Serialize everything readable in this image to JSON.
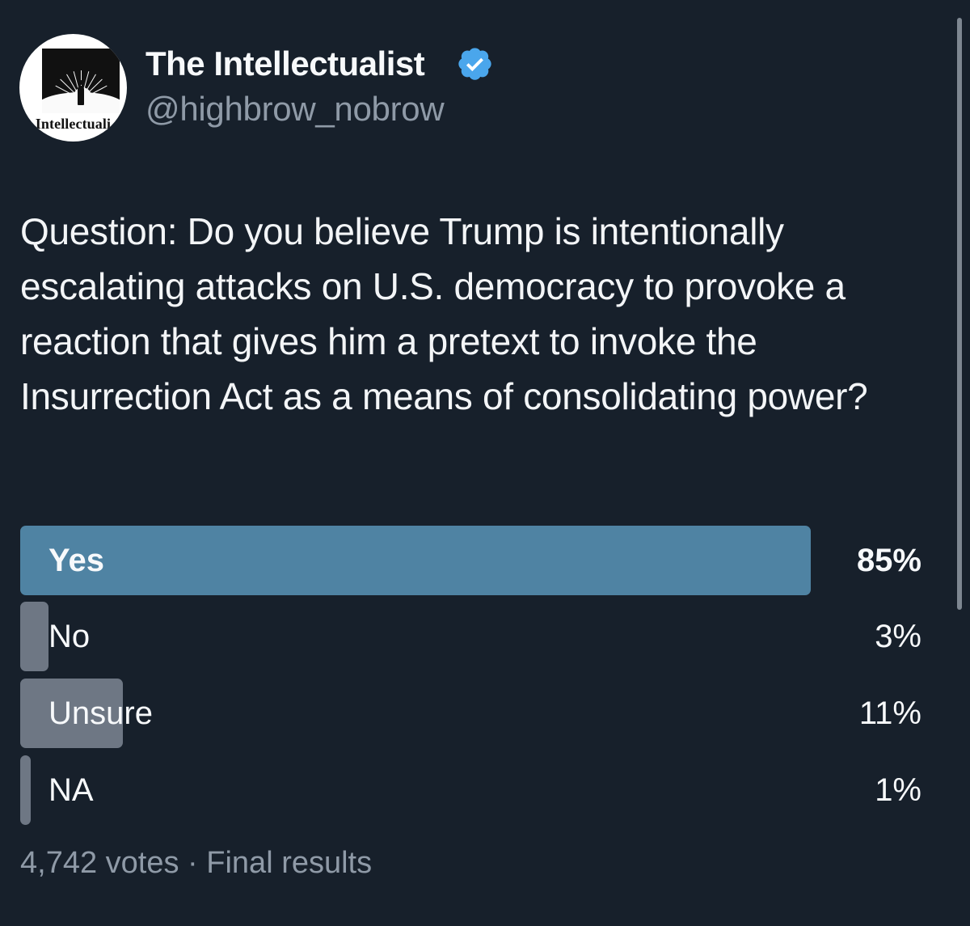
{
  "account": {
    "name": "The Intellectualist",
    "handle": "@highbrow_nobrow",
    "avatar_text": "he Intellectuali",
    "verified_icon": "verified-badge-icon",
    "accent": "#4aa6ec"
  },
  "tweet": {
    "text": "Question: Do you believe Trump is intentionally escalating attacks on U.S. democracy to provoke a reaction that gives him a pretext to invoke the Insurrection Act as a means of consolidating power?"
  },
  "poll": {
    "options": [
      {
        "label": "Yes",
        "percent_text": "85%",
        "percent": 85,
        "winner": true
      },
      {
        "label": "No",
        "percent_text": "3%",
        "percent": 3,
        "winner": false
      },
      {
        "label": "Unsure",
        "percent_text": "11%",
        "percent": 11,
        "winner": false
      },
      {
        "label": "NA",
        "percent_text": "1%",
        "percent": 1,
        "winner": false
      }
    ],
    "votes": "4,742 votes",
    "separator": " · ",
    "status": "Final results",
    "colors": {
      "winner": "#4f83a3",
      "other": "#6e7784",
      "background": "#17202b"
    }
  }
}
